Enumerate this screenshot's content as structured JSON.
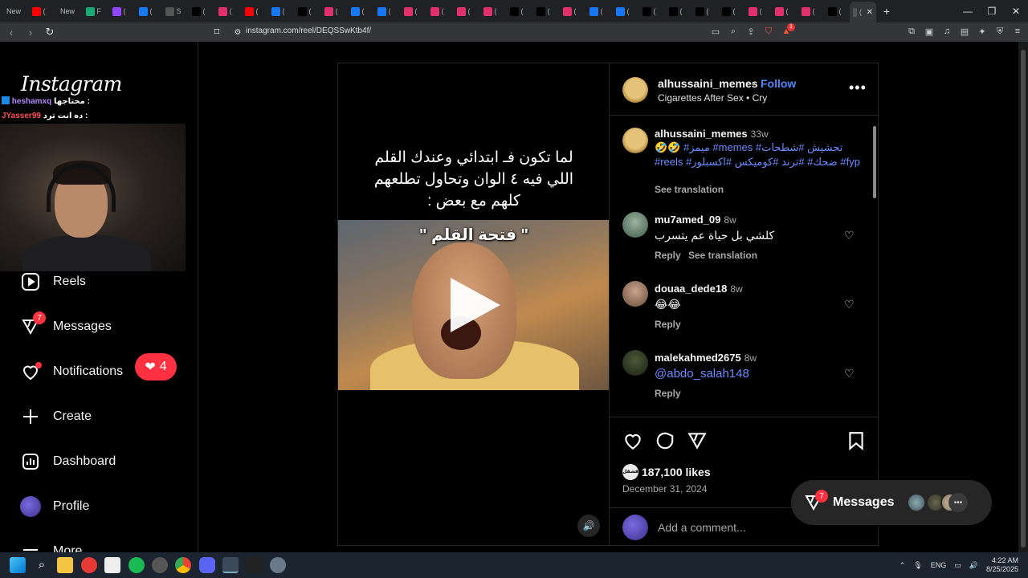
{
  "browser": {
    "tabs": [
      {
        "label": "New",
        "color": "#3a3a3a"
      },
      {
        "label": "(",
        "color": "#ff0000"
      },
      {
        "label": "New",
        "color": "#3a3a3a"
      },
      {
        "label": "F",
        "color": "#19a974"
      },
      {
        "label": "(",
        "color": "#9146ff"
      },
      {
        "label": "(",
        "color": "#1877f2"
      },
      {
        "label": "S",
        "color": "#555"
      },
      {
        "label": "(",
        "color": "#000"
      },
      {
        "label": "(",
        "color": "#e1306c"
      },
      {
        "label": "(",
        "color": "#ff0000"
      },
      {
        "label": "(",
        "color": "#1877f2"
      },
      {
        "label": "(",
        "color": "#000"
      },
      {
        "label": "(",
        "color": "#e1306c"
      },
      {
        "label": "(",
        "color": "#1877f2"
      },
      {
        "label": "(",
        "color": "#1877f2"
      },
      {
        "label": "(",
        "color": "#e1306c"
      },
      {
        "label": "(",
        "color": "#e1306c"
      },
      {
        "label": "(",
        "color": "#e1306c"
      },
      {
        "label": "(",
        "color": "#e1306c"
      },
      {
        "label": "(",
        "color": "#000"
      },
      {
        "label": "(",
        "color": "#000"
      },
      {
        "label": "(",
        "color": "#e1306c"
      },
      {
        "label": "(",
        "color": "#1877f2"
      },
      {
        "label": "(",
        "color": "#1877f2"
      },
      {
        "label": "(",
        "color": "#000"
      },
      {
        "label": "(",
        "color": "#000"
      },
      {
        "label": "(",
        "color": "#000"
      },
      {
        "label": "(",
        "color": "#000"
      },
      {
        "label": "(",
        "color": "#e1306c"
      },
      {
        "label": "(",
        "color": "#e1306c"
      },
      {
        "label": "(",
        "color": "#e1306c"
      },
      {
        "label": "(",
        "color": "#000"
      },
      {
        "label": "(",
        "color": "#555"
      }
    ],
    "url": "instagram.com/reel/DEQSSwKtb4f/",
    "extension_badge": "1"
  },
  "stream_overlay": {
    "chat": [
      {
        "user": "heshamxq",
        "message": "محتاجها :"
      },
      {
        "user": "JYasser99",
        "message": "ده انت ترد :"
      }
    ]
  },
  "sidebar": {
    "logo": "Instagram",
    "items": [
      {
        "label": "Reels",
        "icon": "reels-icon"
      },
      {
        "label": "Messages",
        "icon": "messages-icon",
        "badge": "7"
      },
      {
        "label": "Notifications",
        "icon": "heart-icon",
        "pill_count": "4"
      },
      {
        "label": "Create",
        "icon": "plus-icon"
      },
      {
        "label": "Dashboard",
        "icon": "dashboard-icon"
      },
      {
        "label": "Profile",
        "icon": "avatar-icon"
      },
      {
        "label": "More",
        "icon": "menu-icon"
      }
    ]
  },
  "post": {
    "caption_overlay": "لما تكون فـ ابتدائي وعندك القلم اللي فيه ٤ الوان وتحاول تطلعهم كلهم مع بعض :",
    "video_title": "\" فتحة القلم \"",
    "author": "alhussaini_memes",
    "follow_label": "Follow",
    "separator": "•",
    "audio": "Cigarettes After Sex • Cry",
    "caption": {
      "user": "alhussaini_memes",
      "time": "33w",
      "text": "🤣🤣 #ميمز #memes #تحشيش #شطحات #reels #ضحك# #ترند #كوميكس #اكسبلور #fyp",
      "see_translation": "See translation"
    },
    "comments": [
      {
        "user": "mu7amed_09",
        "time": "8w",
        "text": "كلشي بل حياة عم يتسرب",
        "reply": "Reply",
        "see_translation": "See translation"
      },
      {
        "user": "douaa_dede18",
        "time": "8w",
        "text": "😂😂",
        "reply": "Reply"
      },
      {
        "user": "malekahmed2675",
        "time": "8w",
        "text": "@abdo_salah148",
        "reply": "Reply"
      }
    ],
    "likes": "187,100 likes",
    "liked_by_avatar": "قشقل",
    "date": "December 31, 2024",
    "add_comment_placeholder": "Add a comment..."
  },
  "messages_float": {
    "label": "Messages",
    "badge": "7"
  },
  "taskbar": {
    "language": "ENG",
    "time": "4:22 AM",
    "date": "8/25/2025"
  }
}
